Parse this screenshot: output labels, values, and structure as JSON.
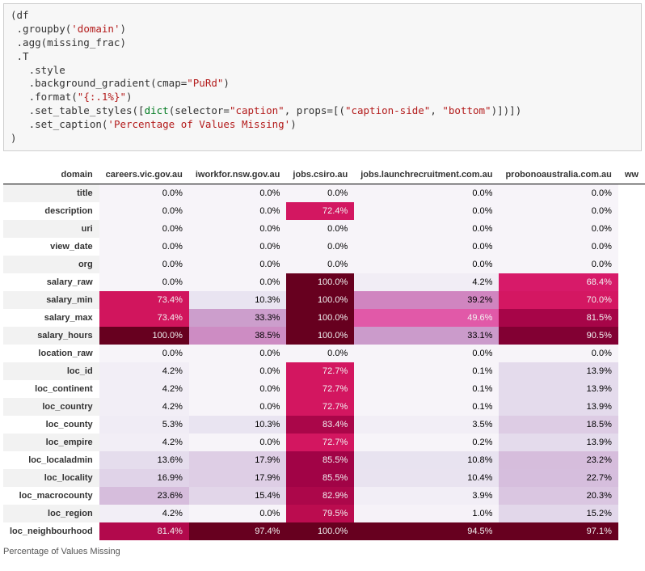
{
  "code": {
    "l1": "(df",
    "l2_a": " .groupby(",
    "l2_s": "'domain'",
    "l2_b": ")",
    "l3": " .agg(missing_frac)",
    "l4": " .T",
    "l5": "   .style",
    "l6_a": "   .background_gradient(cmap=",
    "l6_s": "\"PuRd\"",
    "l6_b": ")",
    "l7_a": "   .format(",
    "l7_s": "\"{:.1%}\"",
    "l7_b": ")",
    "l8_a": "   .set_table_styles([",
    "l8_dict": "dict",
    "l8_b": "(selector=",
    "l8_s1": "\"caption\"",
    "l8_c": ", props=[(",
    "l8_s2": "\"caption-side\"",
    "l8_d": ", ",
    "l8_s3": "\"bottom\"",
    "l8_e": ")])])",
    "l9_a": "   .set_caption(",
    "l9_s": "'Percentage of Values Missing'",
    "l9_b": ")",
    "l10": ")"
  },
  "table": {
    "caption": "Percentage of Values Missing",
    "row_header_label": "domain",
    "columns": [
      "careers.vic.gov.au",
      "iworkfor.nsw.gov.au",
      "jobs.csiro.au",
      "jobs.launchrecruitment.com.au",
      "probonoaustralia.com.au",
      "ww"
    ],
    "rows": [
      {
        "name": "title",
        "v": [
          0.0,
          0.0,
          0.0,
          0.0,
          0.0
        ]
      },
      {
        "name": "description",
        "v": [
          0.0,
          0.0,
          72.4,
          0.0,
          0.0
        ]
      },
      {
        "name": "uri",
        "v": [
          0.0,
          0.0,
          0.0,
          0.0,
          0.0
        ]
      },
      {
        "name": "view_date",
        "v": [
          0.0,
          0.0,
          0.0,
          0.0,
          0.0
        ]
      },
      {
        "name": "org",
        "v": [
          0.0,
          0.0,
          0.0,
          0.0,
          0.0
        ]
      },
      {
        "name": "salary_raw",
        "v": [
          0.0,
          0.0,
          100.0,
          4.2,
          68.4
        ]
      },
      {
        "name": "salary_min",
        "v": [
          73.4,
          10.3,
          100.0,
          39.2,
          70.0
        ]
      },
      {
        "name": "salary_max",
        "v": [
          73.4,
          33.3,
          100.0,
          49.6,
          81.5
        ]
      },
      {
        "name": "salary_hours",
        "v": [
          100.0,
          38.5,
          100.0,
          33.1,
          90.5
        ]
      },
      {
        "name": "location_raw",
        "v": [
          0.0,
          0.0,
          0.0,
          0.0,
          0.0
        ]
      },
      {
        "name": "loc_id",
        "v": [
          4.2,
          0.0,
          72.7,
          0.1,
          13.9
        ]
      },
      {
        "name": "loc_continent",
        "v": [
          4.2,
          0.0,
          72.7,
          0.1,
          13.9
        ]
      },
      {
        "name": "loc_country",
        "v": [
          4.2,
          0.0,
          72.7,
          0.1,
          13.9
        ]
      },
      {
        "name": "loc_county",
        "v": [
          5.3,
          10.3,
          83.4,
          3.5,
          18.5
        ]
      },
      {
        "name": "loc_empire",
        "v": [
          4.2,
          0.0,
          72.7,
          0.2,
          13.9
        ]
      },
      {
        "name": "loc_localadmin",
        "v": [
          13.6,
          17.9,
          85.5,
          10.8,
          23.2
        ]
      },
      {
        "name": "loc_locality",
        "v": [
          16.9,
          17.9,
          85.5,
          10.4,
          22.7
        ]
      },
      {
        "name": "loc_macrocounty",
        "v": [
          23.6,
          15.4,
          82.9,
          3.9,
          20.3
        ]
      },
      {
        "name": "loc_region",
        "v": [
          4.2,
          0.0,
          79.5,
          1.0,
          15.2
        ]
      },
      {
        "name": "loc_neighbourhood",
        "v": [
          81.4,
          97.4,
          100.0,
          94.5,
          97.1
        ]
      }
    ]
  },
  "chart_data": {
    "type": "heatmap",
    "title": "Percentage of Values Missing",
    "xlabel": "domain",
    "ylabel": "",
    "colormap": "PuRd",
    "value_range": [
      0,
      100
    ],
    "x_categories": [
      "careers.vic.gov.au",
      "iworkfor.nsw.gov.au",
      "jobs.csiro.au",
      "jobs.launchrecruitment.com.au",
      "probonoaustralia.com.au"
    ],
    "y_categories": [
      "title",
      "description",
      "uri",
      "view_date",
      "org",
      "salary_raw",
      "salary_min",
      "salary_max",
      "salary_hours",
      "location_raw",
      "loc_id",
      "loc_continent",
      "loc_country",
      "loc_county",
      "loc_empire",
      "loc_localadmin",
      "loc_locality",
      "loc_macrocounty",
      "loc_region",
      "loc_neighbourhood"
    ],
    "matrix": [
      [
        0.0,
        0.0,
        0.0,
        0.0,
        0.0
      ],
      [
        0.0,
        0.0,
        72.4,
        0.0,
        0.0
      ],
      [
        0.0,
        0.0,
        0.0,
        0.0,
        0.0
      ],
      [
        0.0,
        0.0,
        0.0,
        0.0,
        0.0
      ],
      [
        0.0,
        0.0,
        0.0,
        0.0,
        0.0
      ],
      [
        0.0,
        0.0,
        100.0,
        4.2,
        68.4
      ],
      [
        73.4,
        10.3,
        100.0,
        39.2,
        70.0
      ],
      [
        73.4,
        33.3,
        100.0,
        49.6,
        81.5
      ],
      [
        100.0,
        38.5,
        100.0,
        33.1,
        90.5
      ],
      [
        0.0,
        0.0,
        0.0,
        0.0,
        0.0
      ],
      [
        4.2,
        0.0,
        72.7,
        0.1,
        13.9
      ],
      [
        4.2,
        0.0,
        72.7,
        0.1,
        13.9
      ],
      [
        4.2,
        0.0,
        72.7,
        0.1,
        13.9
      ],
      [
        5.3,
        10.3,
        83.4,
        3.5,
        18.5
      ],
      [
        4.2,
        0.0,
        72.7,
        0.2,
        13.9
      ],
      [
        13.6,
        17.9,
        85.5,
        10.8,
        23.2
      ],
      [
        16.9,
        17.9,
        85.5,
        10.4,
        22.7
      ],
      [
        23.6,
        15.4,
        82.9,
        3.9,
        20.3
      ],
      [
        4.2,
        0.0,
        79.5,
        1.0,
        15.2
      ],
      [
        81.4,
        97.4,
        100.0,
        94.5,
        97.1
      ]
    ]
  }
}
